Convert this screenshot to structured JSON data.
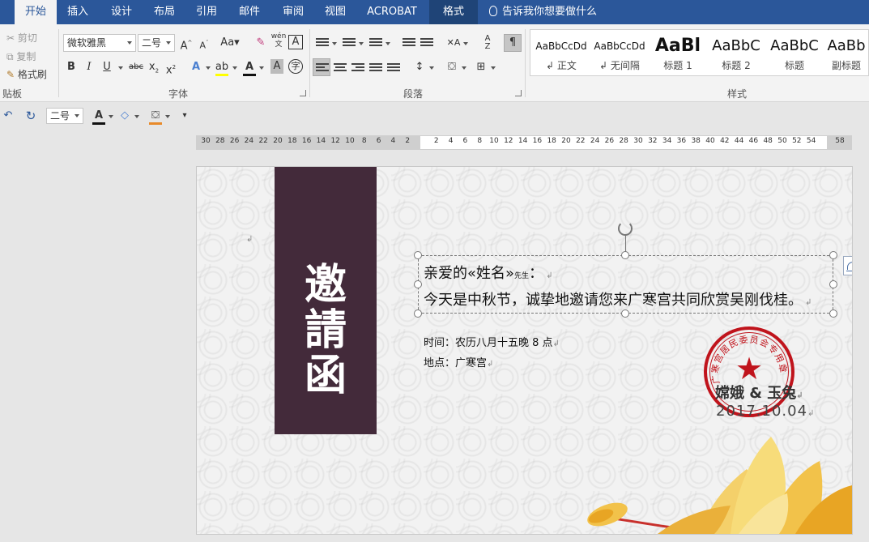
{
  "tabs": [
    {
      "label": "开始",
      "active": true
    },
    {
      "label": "插入"
    },
    {
      "label": "设计"
    },
    {
      "label": "布局"
    },
    {
      "label": "引用"
    },
    {
      "label": "邮件"
    },
    {
      "label": "审阅"
    },
    {
      "label": "视图"
    },
    {
      "label": "ACROBAT"
    },
    {
      "label": "格式",
      "contextual": true
    }
  ],
  "tell_me": "告诉我你想要做什么",
  "clipboard": {
    "cut": "剪切",
    "copy": "复制",
    "format_painter": "格式刷",
    "label": "贴板"
  },
  "font": {
    "name": "微软雅黑",
    "size": "二号",
    "case_label": "Aa",
    "label": "字体",
    "pinyin_label": "wén"
  },
  "paragraph": {
    "label": "段落"
  },
  "styles": {
    "label": "样式",
    "items": [
      {
        "sample": "AaBbCcDd",
        "name": "正文"
      },
      {
        "sample": "AaBbCcDd",
        "name": "无间隔"
      },
      {
        "sample": "AaBl",
        "name": "标题 1"
      },
      {
        "sample": "AaBbC",
        "name": "标题 2"
      },
      {
        "sample": "AaBbC",
        "name": "标题"
      },
      {
        "sample": "AaBb",
        "name": "副标题"
      }
    ]
  },
  "quick_access": {
    "font_size": "二号"
  },
  "ruler": {
    "left_numbers": [
      "30",
      "28",
      "26",
      "24",
      "22",
      "20",
      "18",
      "16",
      "14",
      "12",
      "10",
      "8",
      "6",
      "4",
      "2"
    ],
    "right_numbers": [
      "2",
      "4",
      "6",
      "8",
      "10",
      "12",
      "14",
      "16",
      "18",
      "20",
      "22",
      "24",
      "26",
      "28",
      "30",
      "32",
      "34",
      "36",
      "38",
      "40",
      "42",
      "44",
      "46",
      "48",
      "50",
      "52",
      "54"
    ],
    "end_number": "58"
  },
  "document": {
    "title_chars": [
      "邀",
      "請",
      "函"
    ],
    "greeting_prefix": "亲爱的«姓名»",
    "greeting_suffix_small": "先生",
    "greeting_colon": "：",
    "body": "今天是中秋节，诚挚地邀请您来广寒宫共同欣赏吴刚伐桂。",
    "time": "时间：农历八月十五晚 8 点",
    "place": "地点：广寒宫",
    "seal_text": "广寒宫居民委员会专用章",
    "signers": "嫦娥 & 玉兔",
    "date": "2017.10.04"
  },
  "colors": {
    "tab_bar": "#2b579a",
    "title_bar_bg": "#432a3a",
    "seal_red": "#c0141c"
  }
}
